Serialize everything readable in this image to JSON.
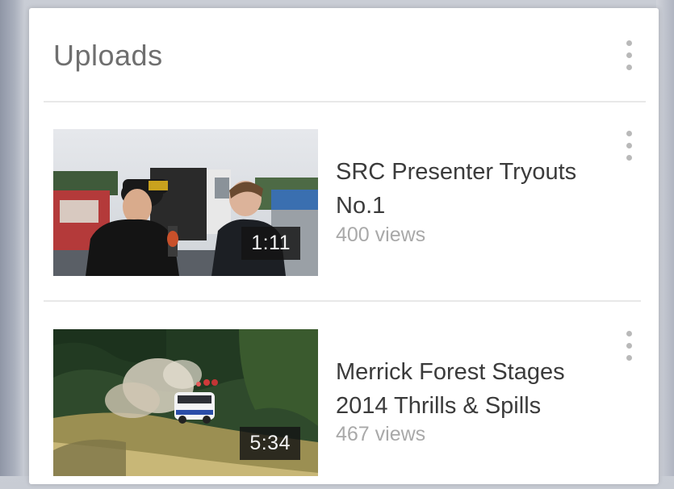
{
  "uploads": {
    "title": "Uploads",
    "menu_icon": "more-vert-icon"
  },
  "videos": [
    {
      "title": "SRC Presenter Tryouts No.1",
      "views": "400 views",
      "duration": "1:11",
      "menu_icon": "more-vert-icon"
    },
    {
      "title": "Merrick Forest Stages 2014 Thrills & Spills",
      "views": "467 views",
      "duration": "5:34",
      "menu_icon": "more-vert-icon"
    }
  ],
  "colors": {
    "card_background": "#ffffff",
    "title_text": "#3b3b3b",
    "secondary_text": "#a9a9a9",
    "duration_badge": "#141414"
  }
}
